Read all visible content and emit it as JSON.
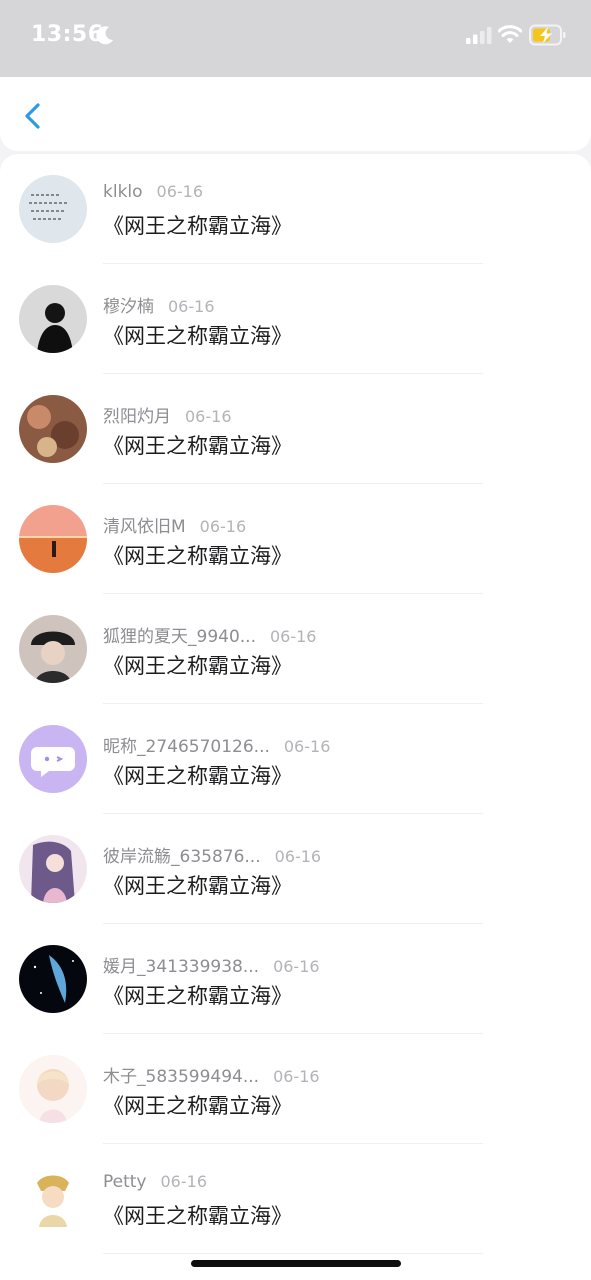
{
  "status_bar": {
    "time": "13:56",
    "moon_icon": "moon-icon",
    "signal_icon": "cellular-signal-icon",
    "wifi_icon": "wifi-icon",
    "battery_icon": "battery-charging-icon",
    "battery_color": "#f5c518"
  },
  "nav": {
    "back_icon": "chevron-left-icon",
    "accent": "#2b9be8"
  },
  "list": {
    "items": [
      {
        "name": "klklo",
        "date": "06-16",
        "message": "《网王之称霸立海》"
      },
      {
        "name": "穆汐楠",
        "date": "06-16",
        "message": "《网王之称霸立海》"
      },
      {
        "name": "烈阳灼月",
        "date": "06-16",
        "message": "《网王之称霸立海》"
      },
      {
        "name": "清风依旧M",
        "date": "06-16",
        "message": "《网王之称霸立海》"
      },
      {
        "name": "狐狸的夏天_9940...",
        "date": "06-16",
        "message": "《网王之称霸立海》"
      },
      {
        "name": "昵称_2746570126...",
        "date": "06-16",
        "message": "《网王之称霸立海》"
      },
      {
        "name": "彼岸流觞_635876...",
        "date": "06-16",
        "message": "《网王之称霸立海》"
      },
      {
        "name": "媛月_341339938...",
        "date": "06-16",
        "message": "《网王之称霸立海》"
      },
      {
        "name": "木子_583599494...",
        "date": "06-16",
        "message": "《网王之称霸立海》"
      },
      {
        "name": "Petty",
        "date": "06-16",
        "message": "《网王之称霸立海》"
      }
    ]
  }
}
